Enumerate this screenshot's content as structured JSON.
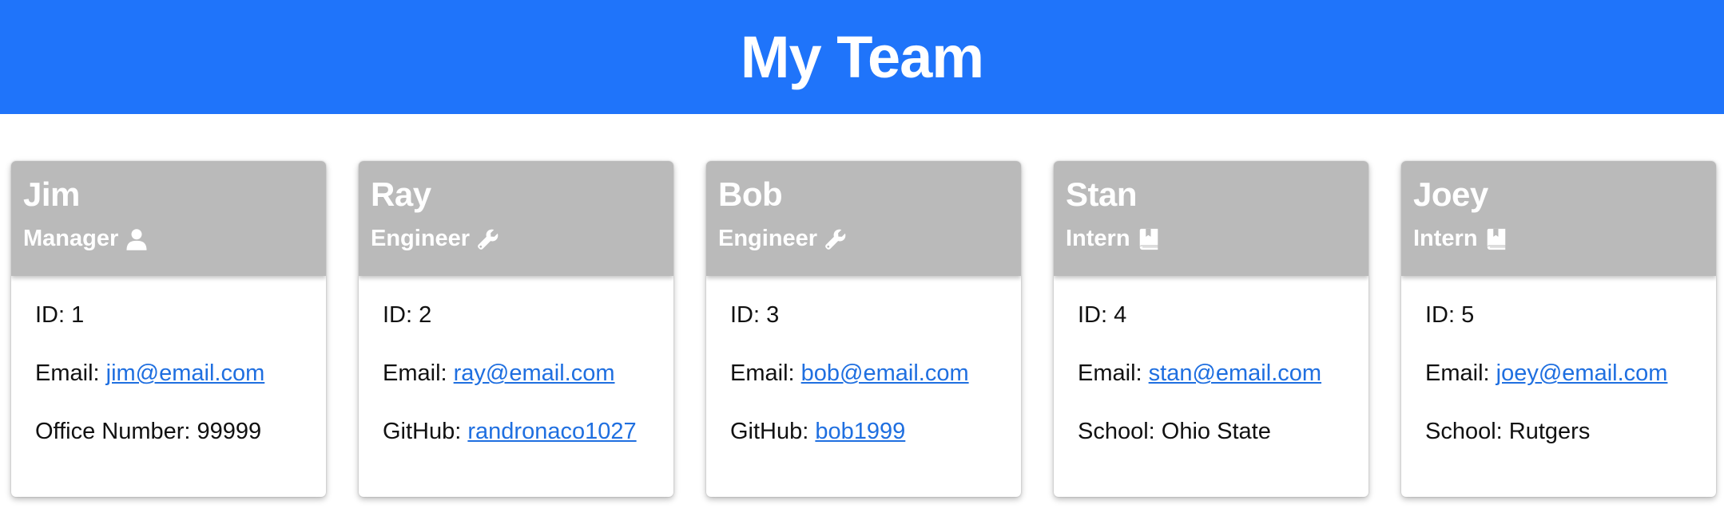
{
  "header": {
    "title": "My Team"
  },
  "colors": {
    "banner": "#1f74fa",
    "card_header": "#bababa",
    "link": "#1f6fe0"
  },
  "members": [
    {
      "name": "Jim",
      "role": "Manager",
      "icon": "user-icon",
      "id": "1",
      "email": "jim@email.com",
      "extra_label": "Office Number:",
      "extra_value": "99999",
      "extra_is_link": false
    },
    {
      "name": "Ray",
      "role": "Engineer",
      "icon": "wrench-icon",
      "id": "2",
      "email": "ray@email.com",
      "extra_label": "GitHub:",
      "extra_value": "randronaco1027",
      "extra_is_link": true
    },
    {
      "name": "Bob",
      "role": "Engineer",
      "icon": "wrench-icon",
      "id": "3",
      "email": "bob@email.com",
      "extra_label": "GitHub:",
      "extra_value": "bob1999",
      "extra_is_link": true
    },
    {
      "name": "Stan",
      "role": "Intern",
      "icon": "book-icon",
      "id": "4",
      "email": "stan@email.com",
      "extra_label": "School:",
      "extra_value": "Ohio State",
      "extra_is_link": false
    },
    {
      "name": "Joey",
      "role": "Intern",
      "icon": "book-icon",
      "id": "5",
      "email": "joey@email.com",
      "extra_label": "School:",
      "extra_value": "Rutgers",
      "extra_is_link": false
    }
  ],
  "labels": {
    "id": "ID:",
    "email": "Email:"
  }
}
